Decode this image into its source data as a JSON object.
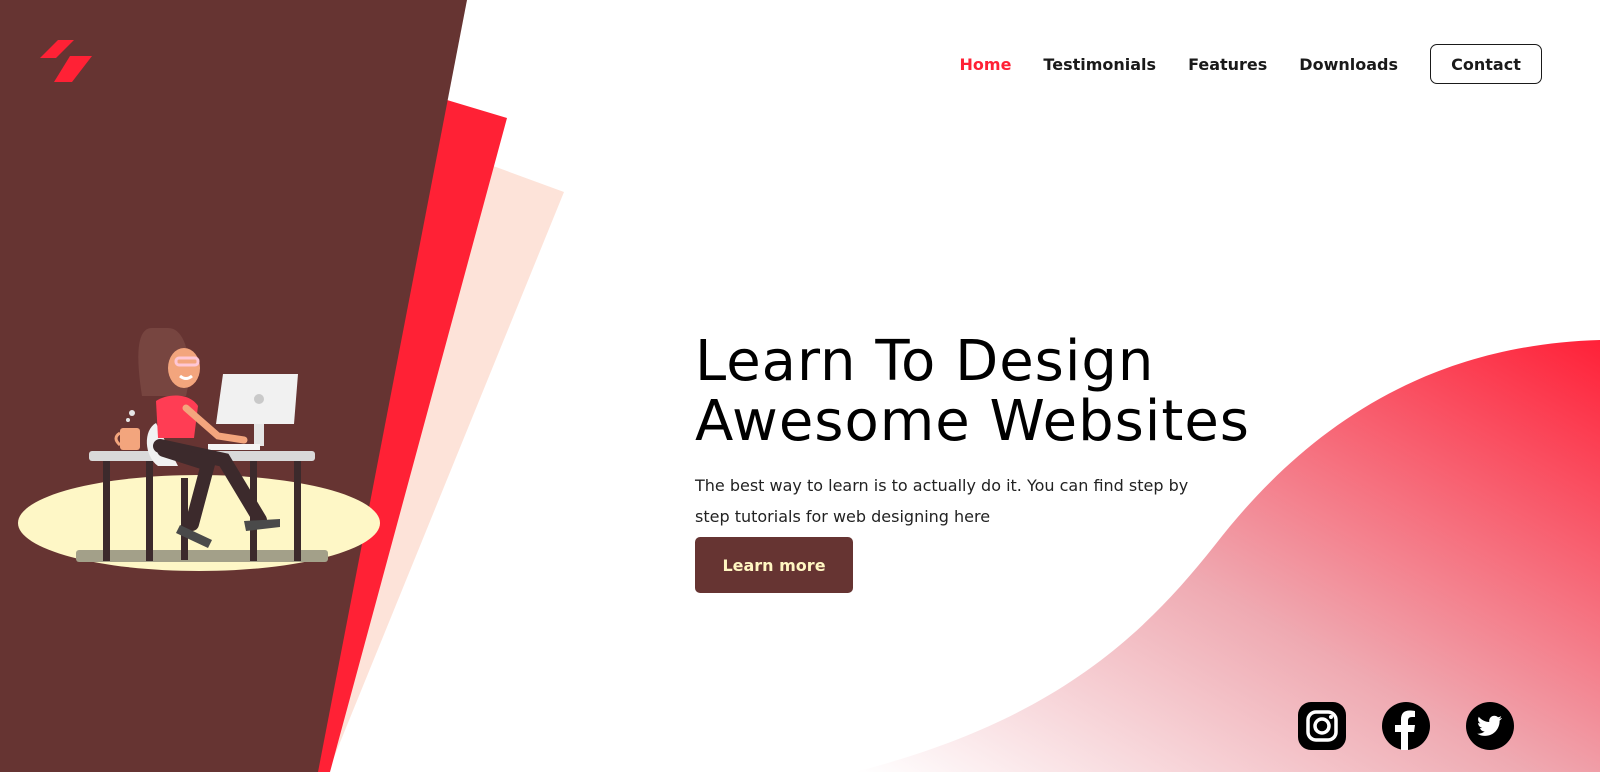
{
  "colors": {
    "brand_dark": "#663432",
    "accent_red": "#ff2135",
    "peach": "#fde3d9",
    "cta_text": "#fff6c2"
  },
  "logo": {
    "icon": "logo-icon"
  },
  "nav": {
    "items": [
      {
        "label": "Home",
        "active": true
      },
      {
        "label": "Testimonials",
        "active": false
      },
      {
        "label": "Features",
        "active": false
      },
      {
        "label": "Downloads",
        "active": false
      }
    ],
    "contact_label": "Contact"
  },
  "hero": {
    "title_line1": "Learn To Design",
    "title_line2": "Awesome Websites",
    "description": "The best way to learn is to actually do it. You can find step by step tutorials for web designing here",
    "cta_label": "Learn more"
  },
  "illustration": {
    "icon": "woman-at-computer-illustration"
  },
  "social": [
    {
      "icon": "instagram-icon"
    },
    {
      "icon": "facebook-icon"
    },
    {
      "icon": "twitter-icon"
    }
  ]
}
